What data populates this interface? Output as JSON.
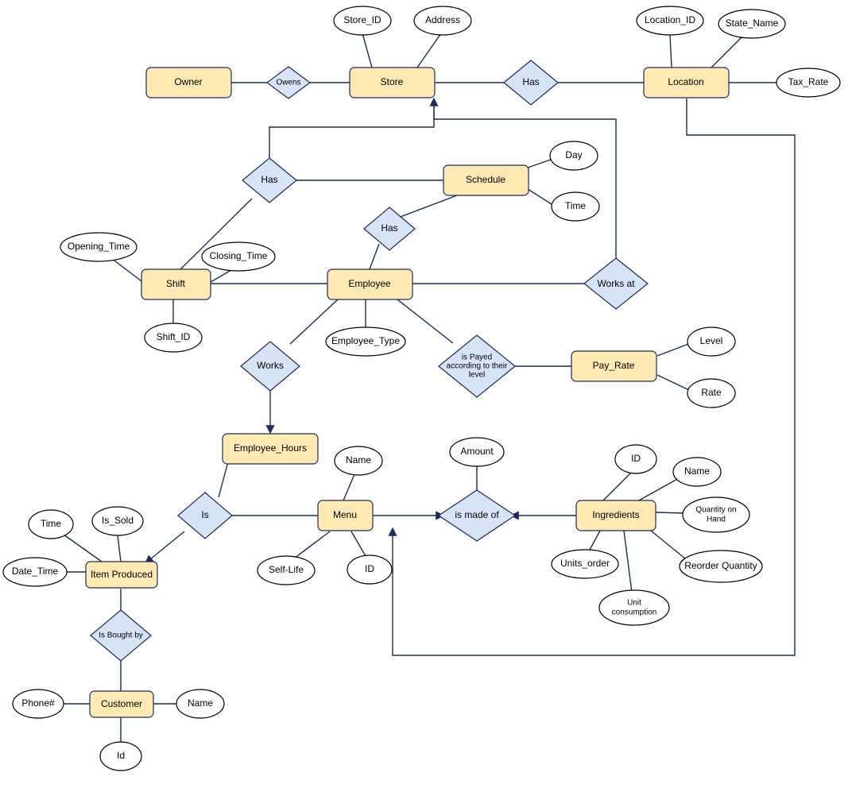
{
  "colors": {
    "entity_fill": "#ffe9b3",
    "relation_fill": "#d6e4f5",
    "attr_fill": "#ffffff",
    "stroke": "#1a2b5c"
  },
  "entities": {
    "owner": "Owner",
    "store": "Store",
    "location": "Location",
    "schedule": "Schedule",
    "shift": "Shift",
    "employee": "Employee",
    "pay_rate": "Pay_Rate",
    "employee_hours": "Employee_Hours",
    "menu": "Menu",
    "ingredients": "Ingredients",
    "item_produced": "Item Produced",
    "customer": "Customer"
  },
  "relationships": {
    "owens": "Owens",
    "store_location_has": "Has",
    "store_schedule_has": "Has",
    "schedule_employee_has": "Has",
    "works_at": "Works at",
    "is_payed_line1": "is Payed",
    "is_payed_line2": "according to their",
    "is_payed_line3": "level",
    "works": "Works",
    "is": "Is",
    "is_made_of": "is made of",
    "is_bought_by": "Is Bought by"
  },
  "attributes": {
    "store_id": "Store_ID",
    "address": "Address",
    "location_id": "Location_ID",
    "state_name": "State_Name",
    "tax_rate": "Tax_Rate",
    "day": "Day",
    "time_sched": "Time",
    "opening_time": "Opening_Time",
    "closing_time": "Closing_Time",
    "shift_id": "Shift_ID",
    "employee_type": "Employee_Type",
    "level": "Level",
    "rate": "Rate",
    "menu_name": "Name",
    "menu_id": "ID",
    "self_life": "Self-Life",
    "amount": "Amount",
    "ing_id": "ID",
    "ing_name": "Name",
    "qoh": "Quantity on",
    "qoh2": "Hand",
    "reorder_qty": "Reorder Quantity",
    "units_order": "Units_order",
    "unit_consumption": "Unit",
    "unit_consumption2": "consumption",
    "ip_time": "Time",
    "is_sold": "Is_Sold",
    "date_time": "Date_Time",
    "phone": "Phone#",
    "cust_name": "Name",
    "cust_id": "Id"
  }
}
